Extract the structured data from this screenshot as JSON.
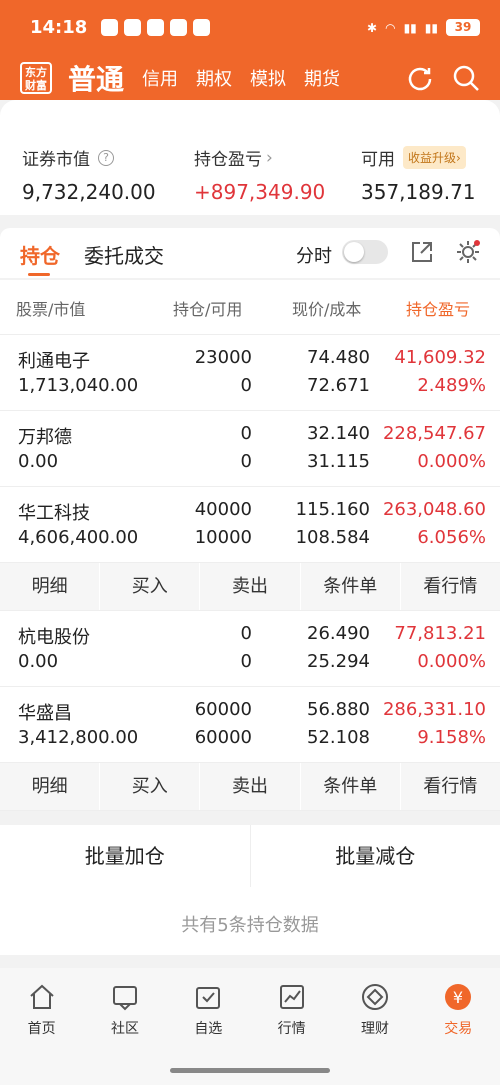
{
  "status_bar": {
    "time": "14:18",
    "battery": "39"
  },
  "header": {
    "logo_text": "东方财富",
    "main_tab": "普通",
    "tabs": [
      "信用",
      "期权",
      "模拟",
      "期货"
    ]
  },
  "summary": {
    "market_value_label": "证券市值",
    "market_value": "9,732,240.00",
    "pnl_label": "持仓盈亏",
    "pnl": "+897,349.90",
    "available_label": "可用",
    "available_badge": "收益升级",
    "available": "357,189.71"
  },
  "section_tabs": {
    "holdings": "持仓",
    "orders": "委托成交",
    "timeshare": "分时"
  },
  "table": {
    "headers": {
      "stock": "股票/市值",
      "position": "持仓/可用",
      "price": "现价/成本",
      "pnl": "持仓盈亏"
    },
    "rows": [
      {
        "name": "利通电子",
        "value": "1,713,040.00",
        "position": "23000",
        "available": "0",
        "price": "74.480",
        "cost": "72.671",
        "pnl": "41,609.32",
        "pnl_pct": "2.489%"
      },
      {
        "name": "万邦德",
        "value": "0.00",
        "position": "0",
        "available": "0",
        "price": "32.140",
        "cost": "31.115",
        "pnl": "228,547.67",
        "pnl_pct": "0.000%"
      },
      {
        "name": "华工科技",
        "value": "4,606,400.00",
        "position": "40000",
        "available": "10000",
        "price": "115.160",
        "cost": "108.584",
        "pnl": "263,048.60",
        "pnl_pct": "6.056%"
      },
      {
        "name": "杭电股份",
        "value": "0.00",
        "position": "0",
        "available": "0",
        "price": "26.490",
        "cost": "25.294",
        "pnl": "77,813.21",
        "pnl_pct": "0.000%"
      },
      {
        "name": "华盛昌",
        "value": "3,412,800.00",
        "position": "60000",
        "available": "60000",
        "price": "56.880",
        "cost": "52.108",
        "pnl": "286,331.10",
        "pnl_pct": "9.158%"
      }
    ],
    "actions": [
      "明细",
      "买入",
      "卖出",
      "条件单",
      "看行情"
    ]
  },
  "batch": {
    "add": "批量加仓",
    "reduce": "批量减仓"
  },
  "count_text": "共有5条持仓数据",
  "bottom_nav": [
    "首页",
    "社区",
    "自选",
    "行情",
    "理财",
    "交易"
  ],
  "colors": {
    "accent": "#f0672a",
    "gain": "#e0353a"
  }
}
